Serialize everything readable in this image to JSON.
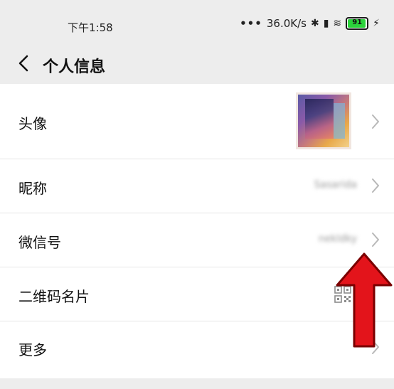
{
  "status_bar": {
    "time": "下午1:58",
    "network_speed": "36.0K/s",
    "battery_level": "91",
    "colors": {
      "battery_fill": "#2bd33b"
    }
  },
  "header": {
    "title": "个人信息",
    "back_icon": "chevron-left-icon"
  },
  "rows": {
    "avatar": {
      "label": "头像"
    },
    "nickname": {
      "label": "昵称",
      "value": "Sasarida"
    },
    "wechat_id": {
      "label": "微信号",
      "value": "nekldky"
    },
    "qr_card": {
      "label": "二维码名片",
      "icon": "qr-code-icon"
    },
    "more": {
      "label": "更多"
    }
  },
  "annotation": {
    "arrow": "up-arrow",
    "color": "#e3141b"
  }
}
